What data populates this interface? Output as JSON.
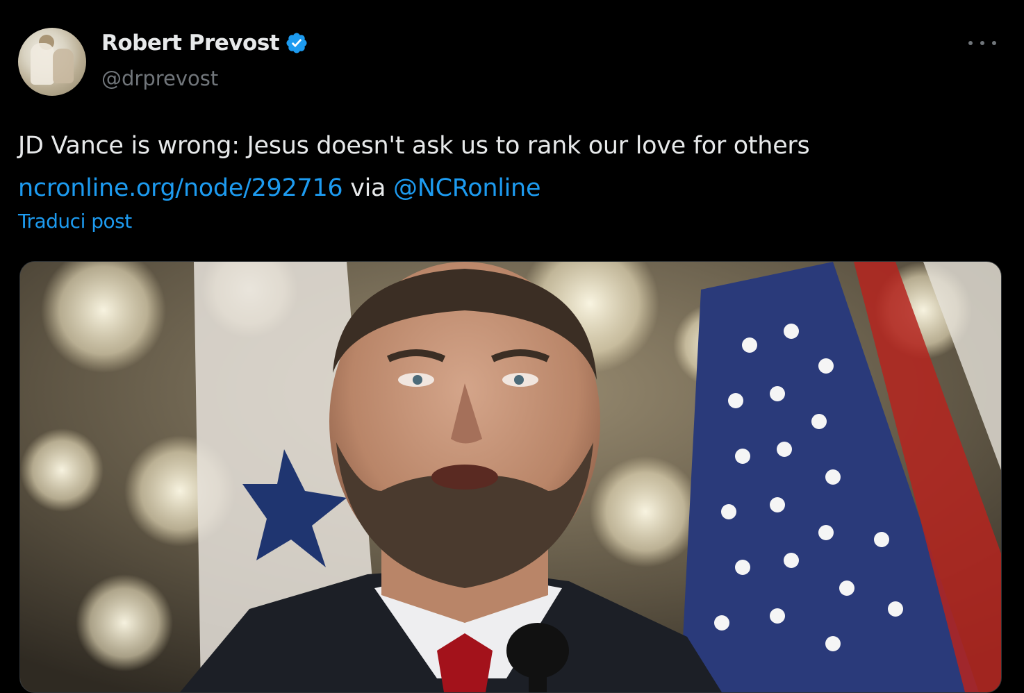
{
  "post": {
    "author": {
      "display_name": "Robert Prevost",
      "handle": "@drprevost",
      "verified": true,
      "avatar_icon": "profile-photo"
    },
    "more_icon": "more-horizontal-icon",
    "text_line1": "JD Vance is wrong: Jesus doesn't ask us to rank our love for others",
    "link_url": "ncronline.org/node/292716",
    "via_label": "via",
    "mention": "@NCRonline",
    "translate_label": "Traduci post",
    "media_icon": "photo-of-man-speaking-at-microphone"
  },
  "colors": {
    "background": "#000000",
    "text": "#e7e9ea",
    "secondary": "#71767b",
    "link": "#1d9bf0",
    "verified": "#1d9bf0"
  }
}
